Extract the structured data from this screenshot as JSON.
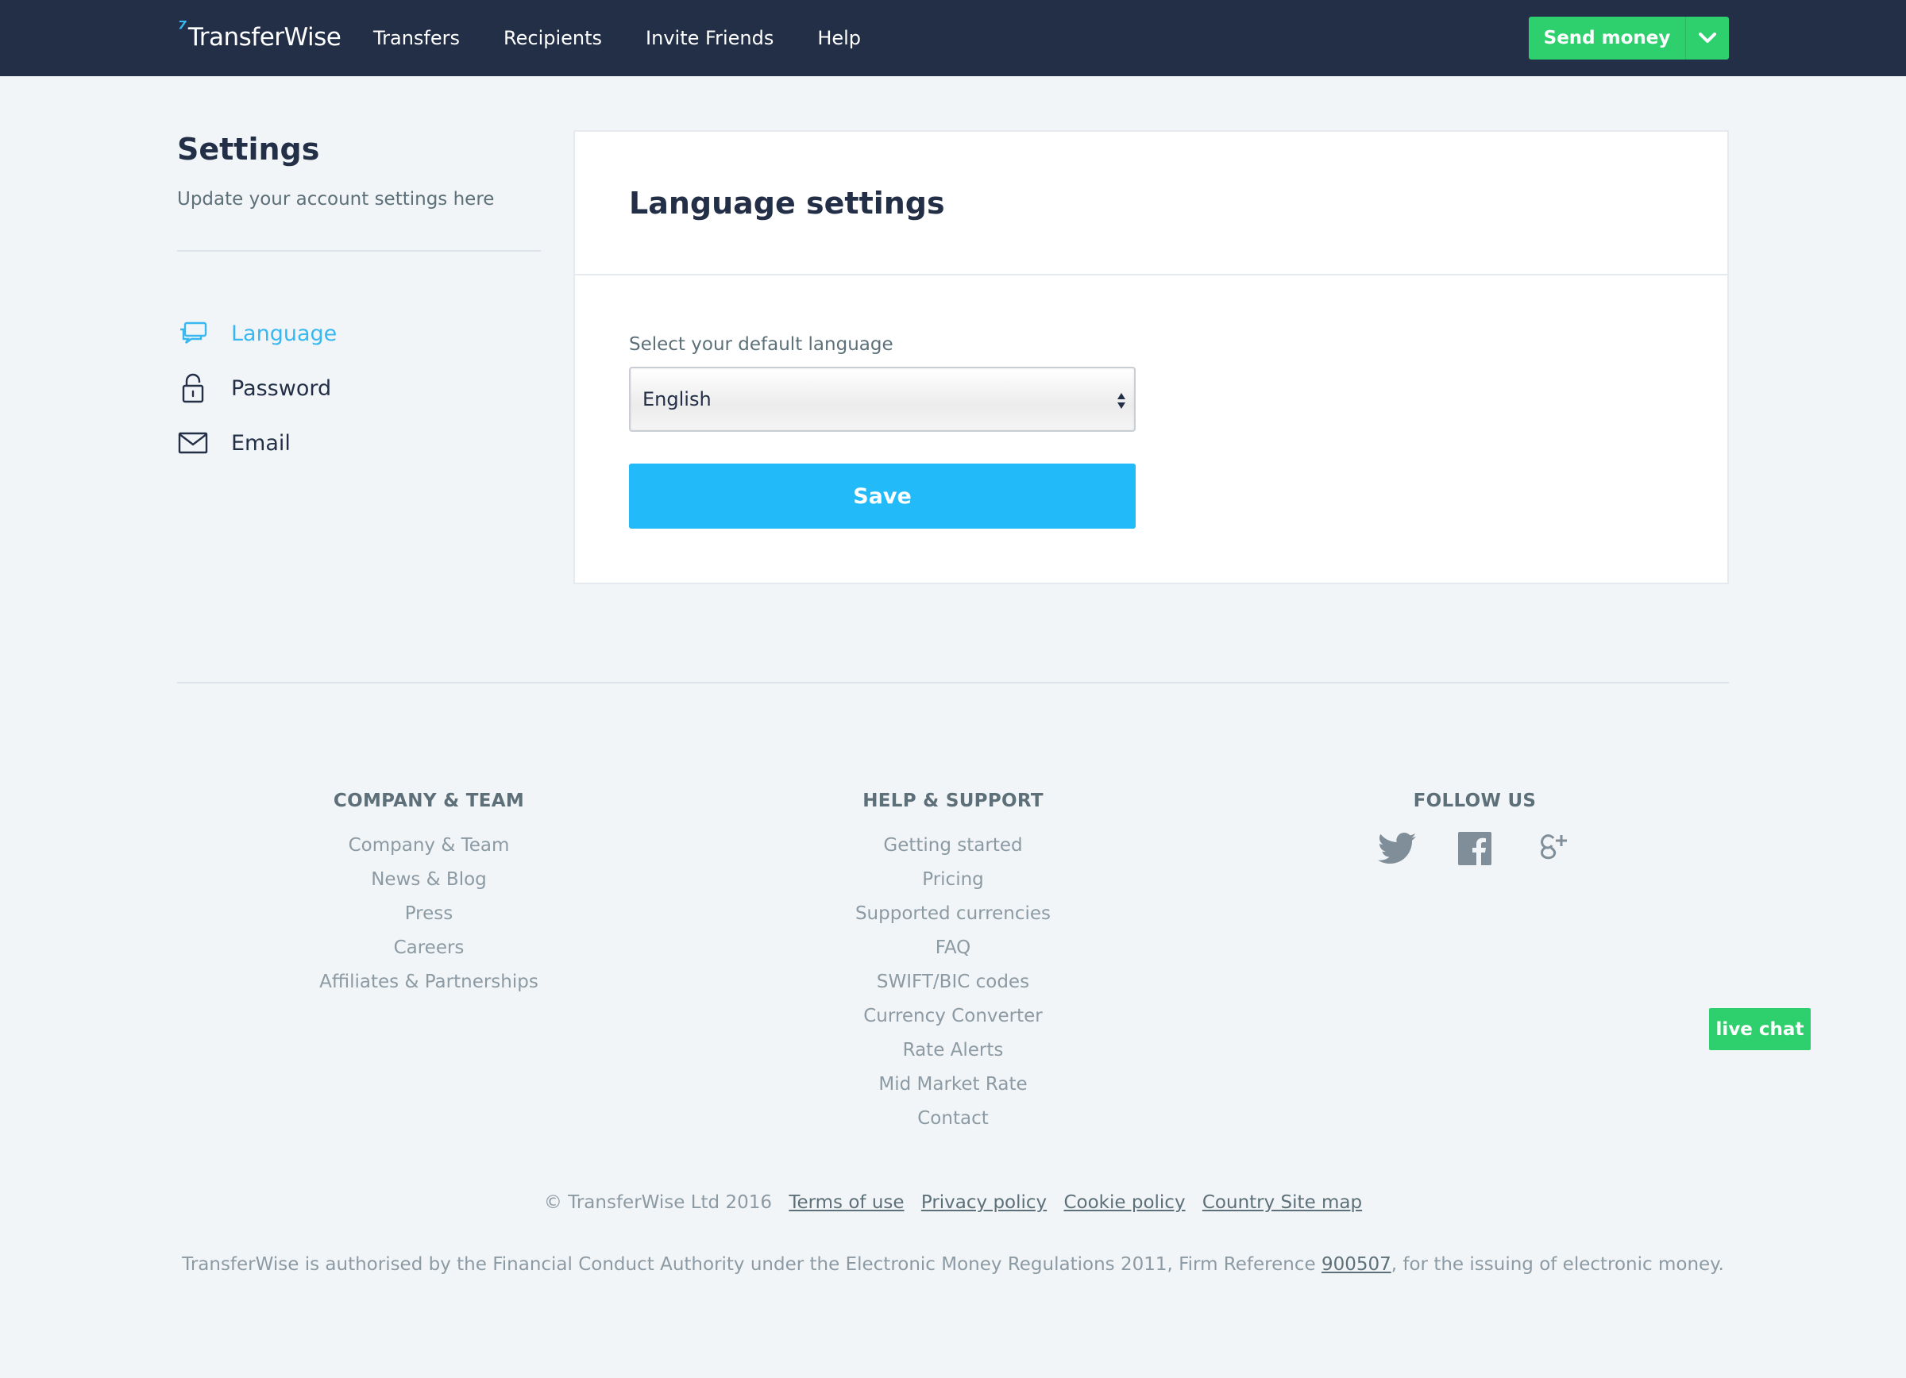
{
  "header": {
    "logo_text": "TransferWise",
    "nav": [
      "Transfers",
      "Recipients",
      "Invite Friends",
      "Help"
    ],
    "send_money_label": "Send money"
  },
  "sidebar": {
    "title": "Settings",
    "subtitle": "Update your account settings here",
    "items": [
      {
        "label": "Language",
        "icon": "chat-bubbles-icon",
        "active": true
      },
      {
        "label": "Password",
        "icon": "lock-icon",
        "active": false
      },
      {
        "label": "Email",
        "icon": "envelope-icon",
        "active": false
      }
    ]
  },
  "card": {
    "title": "Language settings",
    "field_label": "Select your default language",
    "selected_language": "English",
    "save_label": "Save"
  },
  "footer": {
    "company": {
      "heading": "COMPANY & TEAM",
      "links": [
        "Company & Team",
        "News & Blog",
        "Press",
        "Careers",
        "Affiliates & Partnerships"
      ]
    },
    "help": {
      "heading": "HELP & SUPPORT",
      "links": [
        "Getting started",
        "Pricing",
        "Supported currencies",
        "FAQ",
        "SWIFT/BIC codes",
        "Currency Converter",
        "Rate Alerts",
        "Mid Market Rate",
        "Contact"
      ]
    },
    "follow": {
      "heading": "FOLLOW US",
      "icons": [
        "twitter-icon",
        "facebook-icon",
        "google-plus-icon"
      ]
    },
    "copyright": "© TransferWise Ltd 2016",
    "legal_links": [
      "Terms of use",
      "Privacy policy",
      "Cookie policy",
      "Country Site map"
    ],
    "auth_pre": "TransferWise is authorised by the Financial Conduct Authority under the Electronic Money Regulations 2011, Firm Reference ",
    "firm_ref": "900507",
    "auth_post": ", for the issuing of electronic money."
  },
  "live_chat_label": "live chat",
  "colors": {
    "nav_bg": "#222f47",
    "accent_green": "#2ed06e",
    "accent_blue": "#22baf9",
    "active_link": "#37b8f0"
  }
}
